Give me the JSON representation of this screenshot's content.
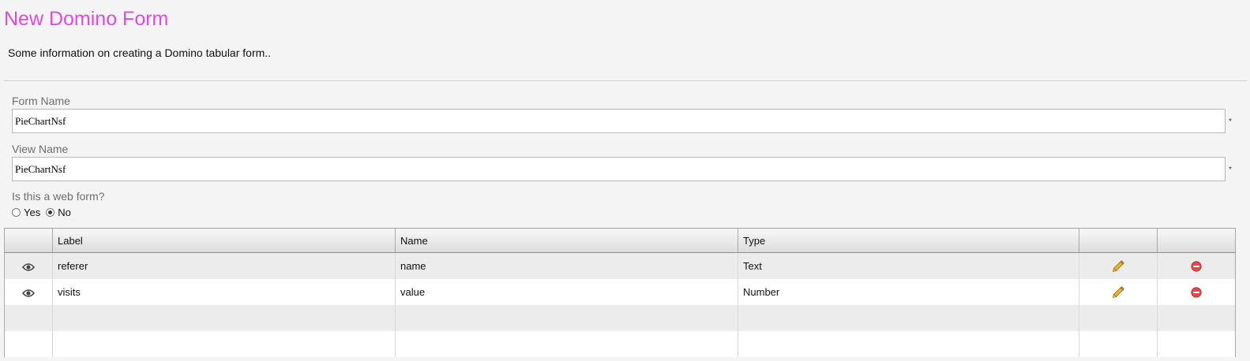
{
  "page": {
    "title": "New Domino Form",
    "intro": "Some information on creating a Domino tabular form.."
  },
  "form": {
    "form_name": {
      "label": "Form Name",
      "value": "PieChartNsf",
      "required_mark": "*"
    },
    "view_name": {
      "label": "View Name",
      "value": "PieChartNsf",
      "required_mark": "*"
    },
    "web_form": {
      "label": "Is this a web form?",
      "options": [
        {
          "label": "Yes",
          "selected": false
        },
        {
          "label": "No",
          "selected": true
        }
      ]
    }
  },
  "table": {
    "columns": [
      "",
      "Label",
      "Name",
      "Type",
      "",
      ""
    ],
    "rows": [
      {
        "label": "referer",
        "name": "name",
        "type": "Text"
      },
      {
        "label": "visits",
        "name": "value",
        "type": "Number"
      }
    ],
    "row_icons": {
      "view": "eye-icon",
      "edit": "pencil-icon",
      "delete": "minus-circle-icon"
    }
  },
  "colors": {
    "title": "#dd4be0",
    "delete_icon": "#e24a4a",
    "edit_icon": "#e8b62c"
  }
}
